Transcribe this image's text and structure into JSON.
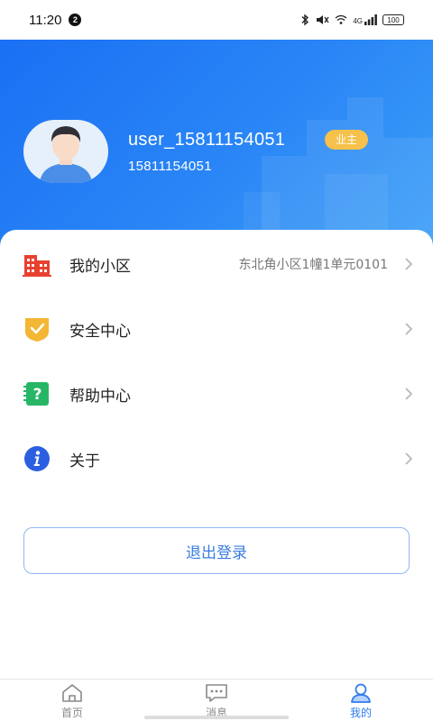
{
  "status_bar": {
    "time": "11:20",
    "notification_count": "2",
    "network": "4G",
    "battery": "100",
    "icons": [
      "bluetooth-icon",
      "mute-icon",
      "wifi-icon",
      "signal-icon",
      "battery-icon"
    ]
  },
  "profile": {
    "username": "user_15811154051",
    "role_badge": "业主",
    "phone": "15811154051",
    "colors": {
      "header_gradient_start": "#1a6ff3",
      "header_gradient_end": "#3da0f7",
      "badge": "#f6c14a"
    }
  },
  "menu": {
    "items": [
      {
        "label": "我的小区",
        "value": "东北角小区1幢1单元0101",
        "icon": "building-icon",
        "color": "#e8412f"
      },
      {
        "label": "安全中心",
        "value": "",
        "icon": "shield-check-icon",
        "color": "#f3b635"
      },
      {
        "label": "帮助中心",
        "value": "",
        "icon": "help-book-icon",
        "color": "#27b665"
      },
      {
        "label": "关于",
        "value": "",
        "icon": "info-icon",
        "color": "#2c5fe0"
      }
    ]
  },
  "logout": {
    "label": "退出登录",
    "color": "#3a7de0"
  },
  "tab_bar": {
    "tabs": [
      {
        "label": "首页",
        "icon": "home-icon",
        "active": false
      },
      {
        "label": "消息",
        "icon": "message-icon",
        "active": false
      },
      {
        "label": "我的",
        "icon": "user-icon",
        "active": true
      }
    ],
    "active_color": "#2f7cf0"
  }
}
